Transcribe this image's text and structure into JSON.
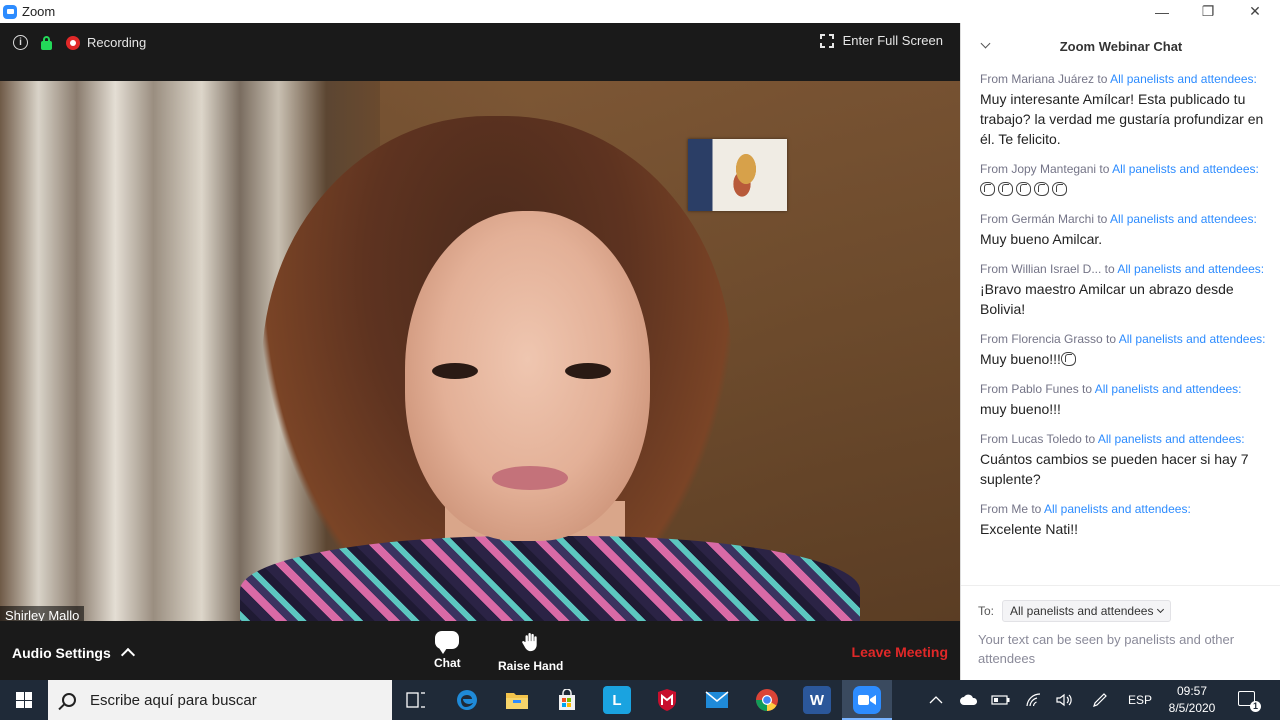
{
  "window": {
    "title": "Zoom",
    "minimize_glyph": "—",
    "maximize_glyph": "❐",
    "close_glyph": "✕"
  },
  "meeting": {
    "recording_label": "Recording",
    "fullscreen_label": "Enter Full Screen",
    "participant_name": "Shirley Mallo",
    "audio_settings_label": "Audio Settings",
    "chat_label": "Chat",
    "raise_hand_label": "Raise Hand",
    "leave_label": "Leave Meeting",
    "info_icon": "info-icon",
    "lock_color": "#23d959",
    "leave_color": "#e02828"
  },
  "chat": {
    "title": "Zoom Webinar Chat",
    "accent_color": "#2d8cff",
    "messages": [
      {
        "from": "From Mariana Juárez to ",
        "to": "All panelists and attendees:",
        "text": "Muy interesante Amílcar! Esta publicado tu trabajo? la verdad me gustaría profundizar en él. Te felicito."
      },
      {
        "from": "From Jopy Mantegani to ",
        "to": "All panelists and attendees:",
        "text": "",
        "claps": 5
      },
      {
        "from": "From Germán Marchi to ",
        "to": "All panelists and attendees:",
        "text": "Muy bueno Amilcar."
      },
      {
        "from": "From Willian Israel D... to ",
        "to": "All panelists and attendees:",
        "text": "¡Bravo maestro Amilcar un abrazo desde Bolivia!"
      },
      {
        "from": "From Florencia Grasso to ",
        "to": "All panelists and attendees:",
        "text": "Muy bueno!!!",
        "claps": 1
      },
      {
        "from": "From Pablo Funes to ",
        "to": "All panelists and attendees:",
        "text": "muy bueno!!!"
      },
      {
        "from": "From Lucas Toledo to ",
        "to": "All panelists and attendees:",
        "text": "Cuántos cambios se pueden hacer si hay 7 suplente?"
      },
      {
        "from": "From Me to ",
        "to": "All panelists and attendees:",
        "text": "Excelente Nati!!"
      }
    ],
    "to_label": "To:",
    "to_selected": "All panelists and attendees",
    "input_placeholder": "Your text can be seen by panelists and other attendees"
  },
  "taskbar": {
    "search_placeholder": "Escribe aquí para buscar",
    "apps": [
      "task-view-icon",
      "edge-icon",
      "file-explorer-icon",
      "store-icon",
      "l-app-icon",
      "mcafee-icon",
      "mail-icon",
      "chrome-icon",
      "word-icon",
      "zoom-icon"
    ],
    "language": "ESP",
    "time": "09:57",
    "date": "8/5/2020",
    "notification_count": "1"
  }
}
